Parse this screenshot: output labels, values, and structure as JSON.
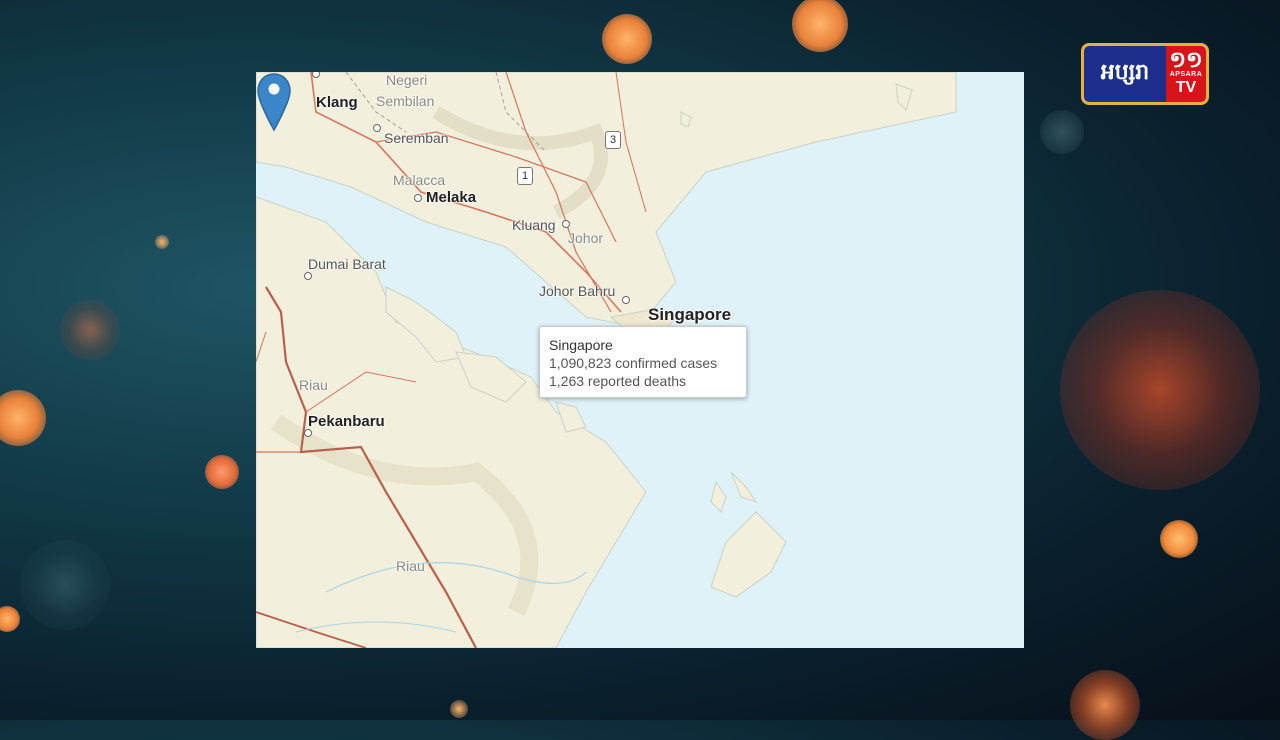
{
  "background": {
    "accent_colors": [
      "#e8813a",
      "#1f5563",
      "#070f18"
    ]
  },
  "map": {
    "labels": {
      "negeri_sembilan": "Negeri Sembilan",
      "negeri_line1": "Negeri",
      "negeri_line2": "Sembilan",
      "klang": "Klang",
      "seremban": "Seremban",
      "malacca": "Malacca",
      "melaka": "Melaka",
      "kluang": "Kluang",
      "johor": "Johor",
      "johor_bahru": "Johor Bahru",
      "singapore": "Singapore",
      "dumai_barat": "Dumai Barat",
      "riau_1": "Riau",
      "pekanbaru": "Pekanbaru",
      "riau_2": "Riau"
    },
    "route_shields": [
      "3",
      "1"
    ],
    "colors": {
      "water": "#dff2f8",
      "land": "#f2efdc",
      "roads": "#d9745a",
      "marker": "#3a86c8"
    }
  },
  "popup": {
    "title": "Singapore",
    "cases": "1,090,823 confirmed cases",
    "deaths": "1,263 reported deaths"
  },
  "logo": {
    "khmer_text": "អប្សរា",
    "number": "១១",
    "apsara": "APSARA",
    "tv": "TV"
  }
}
